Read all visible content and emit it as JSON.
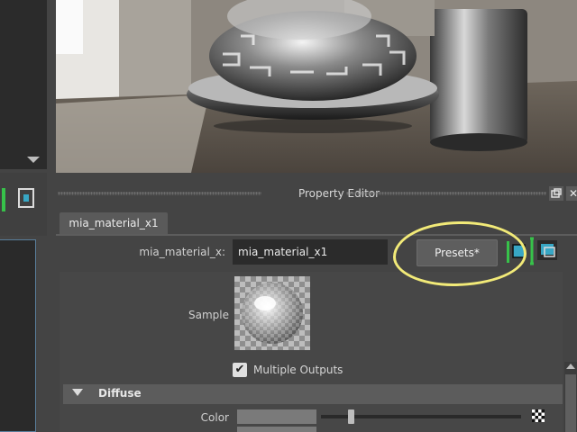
{
  "property_editor": {
    "title": "Property Editor",
    "tab_label": "mia_material_x1",
    "attribute_label": "mia_material_x:",
    "attribute_value": "mia_material_x1",
    "presets_label": "Presets*",
    "sample_label": "Sample",
    "multiple_outputs_label": "Multiple Outputs",
    "multiple_outputs_checked": true,
    "checkbox_glyph": "✔",
    "section_diffuse": "Diffuse",
    "color_label": "Color"
  },
  "icons": {
    "float_panel": "float-panel-icon",
    "close_panel": "close-icon",
    "close_glyph": "✕"
  },
  "colors": {
    "highlight": "#f2ea78",
    "accent_green": "#37c24a",
    "accent_cyan": "#38a7c5"
  }
}
